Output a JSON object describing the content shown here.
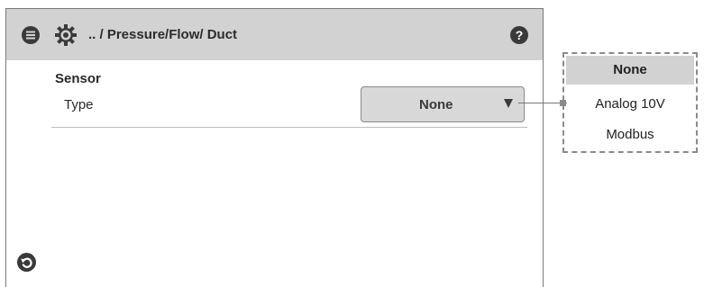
{
  "header": {
    "breadcrumb": ".. / Pressure/Flow/ Duct",
    "menu_icon": "menu-icon",
    "settings_icon": "gear-icon",
    "help_icon": "help-icon",
    "help_glyph": "?"
  },
  "sensor": {
    "section_title": "Sensor",
    "type_label": "Type",
    "type_value": "None",
    "arrow_icon": "caret-down-icon"
  },
  "footer": {
    "back_icon": "back-arrow-icon"
  },
  "dropdown": {
    "options": [
      "None",
      "Analog 10V",
      "Modbus"
    ],
    "selected": "None"
  },
  "colors": {
    "header_bg": "#d2d2d2",
    "select_bg": "#d8d8d8",
    "icon_dark": "#3a3a3a"
  }
}
